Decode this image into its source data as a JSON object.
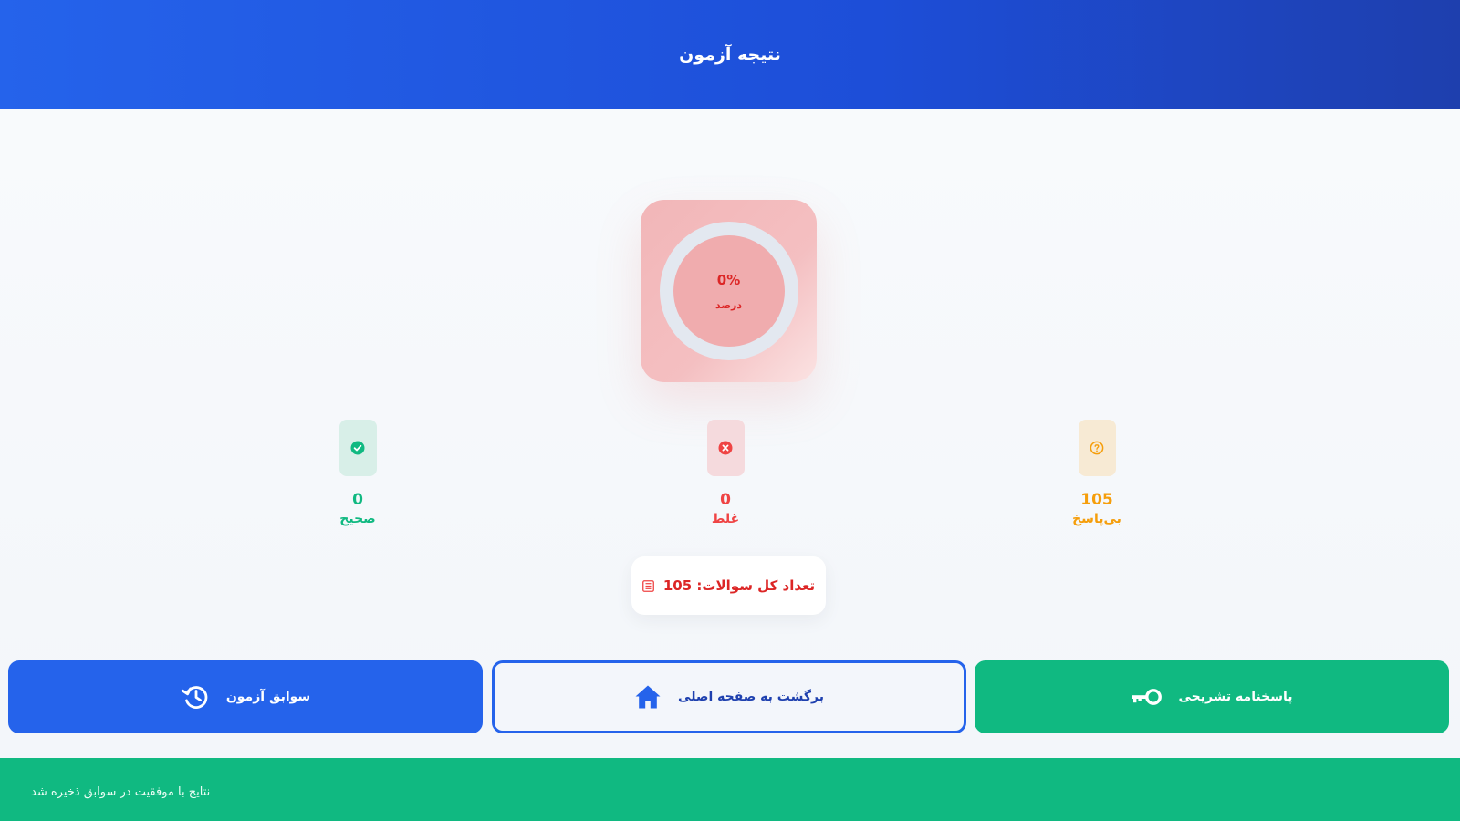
{
  "header": {
    "title": "نتیجه آزمون"
  },
  "score": {
    "percent_text": "0%",
    "label": "درصد",
    "percent": 0
  },
  "stats": {
    "correct": {
      "value": "0",
      "label": "صحیح",
      "icon": "check-circle-icon"
    },
    "wrong": {
      "value": "0",
      "label": "غلط",
      "icon": "x-circle-icon"
    },
    "unanswered": {
      "value": "105",
      "label": "بی‌پاسخ",
      "icon": "question-circle-icon"
    }
  },
  "total": {
    "text": "105 :تعداد کل سوالات",
    "icon": "list-icon"
  },
  "actions": {
    "solutions_label": "پاسخنامه تشریحی",
    "home_label": "برگشت به صفحه اصلی",
    "history_label": "سوابق آزمون"
  },
  "footer": {
    "message": "نتایج با موفقیت در سوابق ذخیره شد"
  },
  "colors": {
    "primary": "#2563eb",
    "success": "#10b981",
    "danger": "#ef4444",
    "warning": "#f59e0b"
  }
}
